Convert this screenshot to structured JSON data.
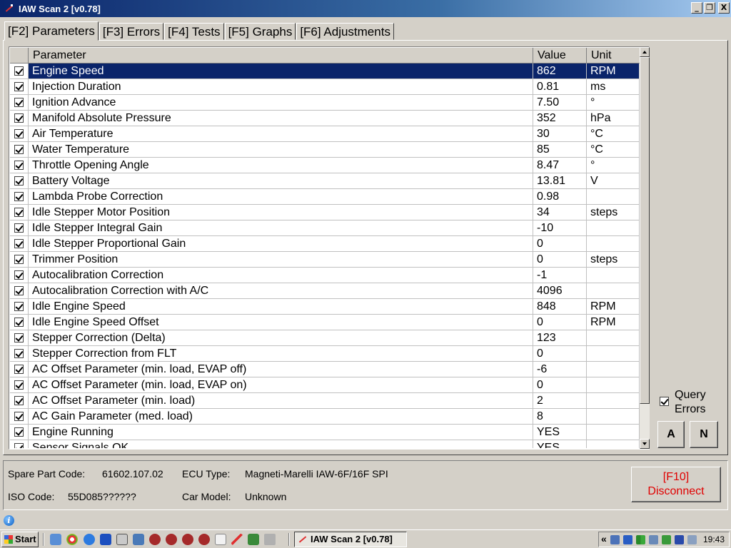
{
  "window": {
    "title": "IAW Scan 2 [v0.78]"
  },
  "window_controls": {
    "minimize": "_",
    "restore": "❐",
    "close": "X"
  },
  "tabs": [
    {
      "label": "[F2] Parameters",
      "active": true
    },
    {
      "label": "[F3] Errors"
    },
    {
      "label": "[F4] Tests"
    },
    {
      "label": "[F5] Graphs"
    },
    {
      "label": "[F6] Adjustments"
    }
  ],
  "grid": {
    "headers": {
      "parameter": "Parameter",
      "value": "Value",
      "unit": "Unit"
    },
    "rows": [
      {
        "name": "Engine Speed",
        "value": "862",
        "unit": "RPM"
      },
      {
        "name": "Injection Duration",
        "value": "0.81",
        "unit": "ms"
      },
      {
        "name": "Ignition Advance",
        "value": "7.50",
        "unit": "°"
      },
      {
        "name": "Manifold Absolute Pressure",
        "value": "352",
        "unit": "hPa"
      },
      {
        "name": "Air Temperature",
        "value": "30",
        "unit": "°C"
      },
      {
        "name": "Water Temperature",
        "value": "85",
        "unit": "°C"
      },
      {
        "name": "Throttle Opening Angle",
        "value": "8.47",
        "unit": "°"
      },
      {
        "name": "Battery Voltage",
        "value": "13.81",
        "unit": "V"
      },
      {
        "name": "Lambda Probe Correction",
        "value": "0.98",
        "unit": ""
      },
      {
        "name": "Idle Stepper Motor Position",
        "value": "34",
        "unit": "steps"
      },
      {
        "name": "Idle Stepper Integral Gain",
        "value": "-10",
        "unit": ""
      },
      {
        "name": "Idle Stepper Proportional Gain",
        "value": "0",
        "unit": ""
      },
      {
        "name": "Trimmer Position",
        "value": "0",
        "unit": "steps"
      },
      {
        "name": "Autocalibration Correction",
        "value": "-1",
        "unit": ""
      },
      {
        "name": "Autocalibration Correction with A/C",
        "value": "4096",
        "unit": ""
      },
      {
        "name": "Idle Engine Speed",
        "value": "848",
        "unit": "RPM"
      },
      {
        "name": "Idle Engine Speed Offset",
        "value": "0",
        "unit": "RPM"
      },
      {
        "name": "Stepper Correction (Delta)",
        "value": "123",
        "unit": ""
      },
      {
        "name": "Stepper Correction from FLT",
        "value": "0",
        "unit": ""
      },
      {
        "name": "AC Offset Parameter (min. load, EVAP off)",
        "value": "-6",
        "unit": ""
      },
      {
        "name": "AC Offset Parameter (min. load, EVAP on)",
        "value": "0",
        "unit": ""
      },
      {
        "name": "AC Offset Parameter (min. load)",
        "value": "2",
        "unit": ""
      },
      {
        "name": "AC Gain Parameter (med. load)",
        "value": "8",
        "unit": ""
      },
      {
        "name": "Engine Running",
        "value": "YES",
        "unit": ""
      },
      {
        "name": "Sensor Signals OK",
        "value": "YES",
        "unit": ""
      }
    ]
  },
  "query": {
    "line1": "Query",
    "line2": "Errors"
  },
  "buttons": {
    "a": "A",
    "n": "N",
    "disconnect_line1": "[F10]",
    "disconnect_line2": "Disconnect"
  },
  "info": {
    "spare_part_label": "Spare Part Code:",
    "spare_part_value": "61602.107.02",
    "ecu_type_label": "ECU Type:",
    "ecu_type_value": "Magneti-Marelli IAW-6F/16F SPI",
    "iso_code_label": "ISO Code:",
    "iso_code_value": "55D085??????",
    "car_model_label": "Car Model:",
    "car_model_value": "Unknown"
  },
  "taskbar": {
    "start": "Start",
    "task": "IAW Scan 2 [v0.78]",
    "tray_chevron": "«",
    "clock": "19:43"
  },
  "colors": {
    "title_gradient_start": "#0a246a",
    "selection": "#0a246a",
    "disconnect_text": "#e00000"
  }
}
